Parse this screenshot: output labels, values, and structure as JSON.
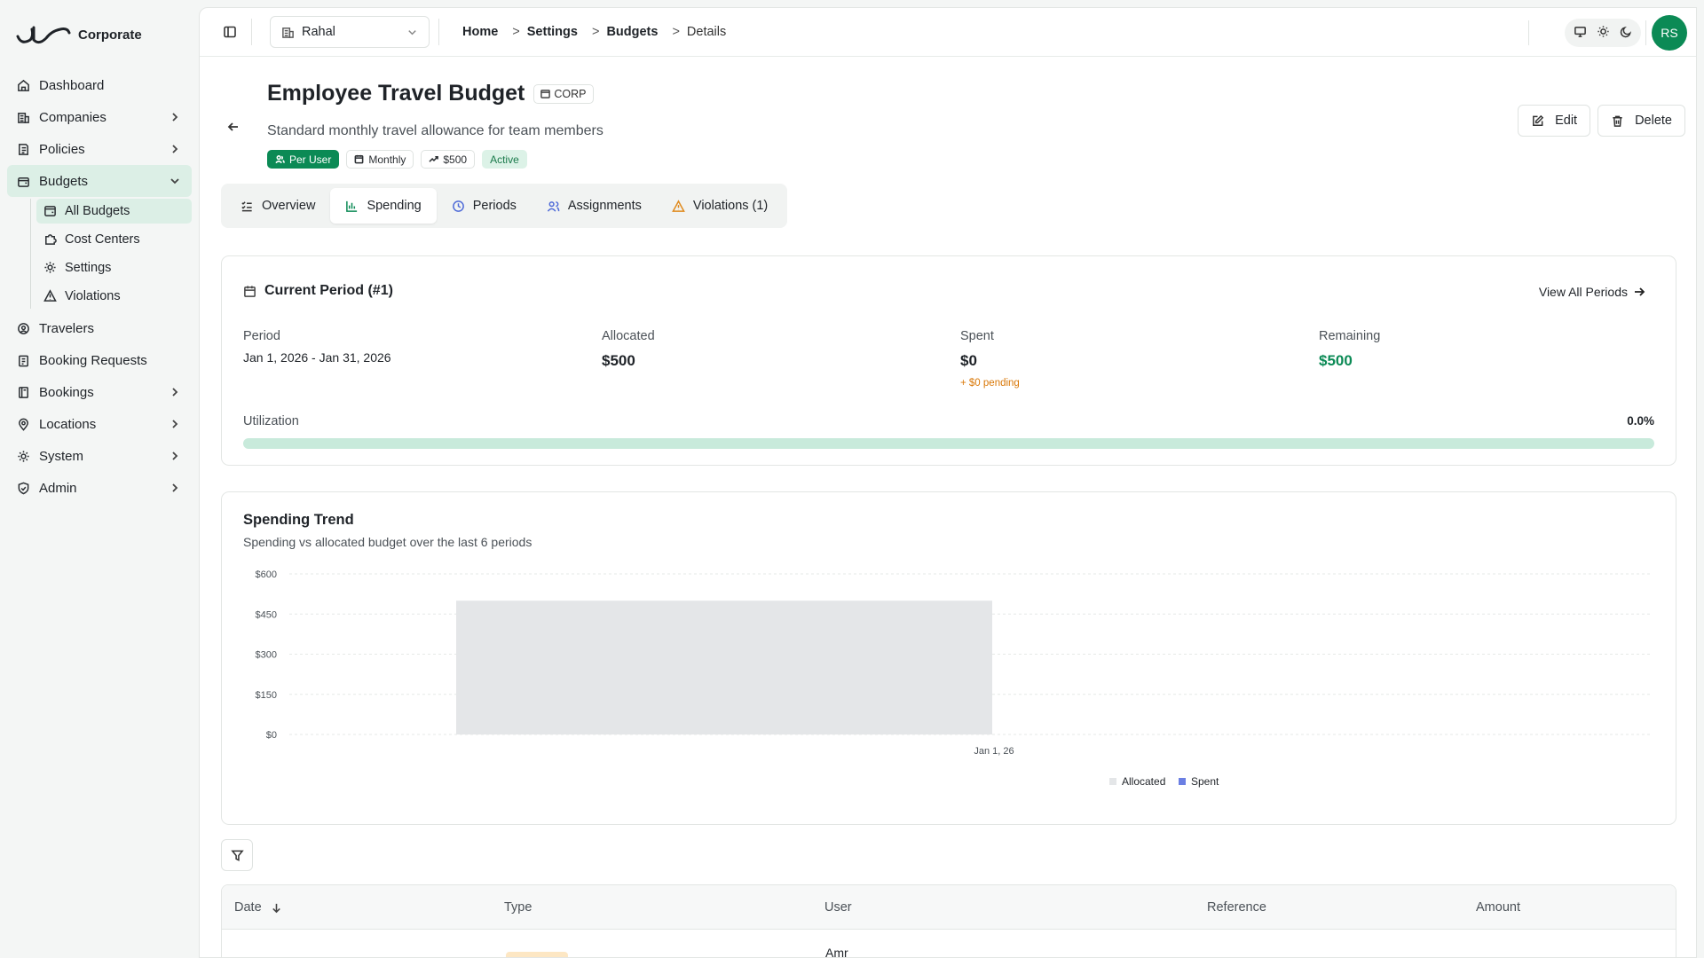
{
  "brand": {
    "name": "Corporate",
    "logo_icon": "logo-icon"
  },
  "sidebar": {
    "items": [
      {
        "label": "Dashboard",
        "icon": "home-icon"
      },
      {
        "label": "Companies",
        "icon": "building-icon"
      },
      {
        "label": "Policies",
        "icon": "policy-icon"
      },
      {
        "label": "Budgets",
        "icon": "wallet-icon"
      },
      {
        "label": "Travelers",
        "icon": "user-circle-icon"
      },
      {
        "label": "Booking Requests",
        "icon": "clipboard-icon"
      },
      {
        "label": "Bookings",
        "icon": "book-icon"
      },
      {
        "label": "Locations",
        "icon": "map-pin-icon"
      },
      {
        "label": "System",
        "icon": "gear-icon"
      },
      {
        "label": "Admin",
        "icon": "shield-icon"
      }
    ],
    "budgets_sub": [
      {
        "label": "All Budgets",
        "icon": "wallet-icon"
      },
      {
        "label": "Cost Centers",
        "icon": "puzzle-icon"
      },
      {
        "label": "Settings",
        "icon": "gear-icon"
      },
      {
        "label": "Violations",
        "icon": "warning-icon"
      }
    ]
  },
  "topbar": {
    "company": "Rahal",
    "breadcrumb": [
      "Home",
      "Settings",
      "Budgets",
      "Details"
    ],
    "breadcrumb_sep": ">",
    "avatar_initials": "RS"
  },
  "budget": {
    "title": "Employee Travel Budget",
    "code": "CORP",
    "description": "Standard monthly travel allowance for team members",
    "chips": {
      "scope": "Per User",
      "frequency": "Monthly",
      "amount": "$500",
      "status": "Active"
    },
    "actions": {
      "edit": "Edit",
      "delete": "Delete"
    }
  },
  "tabs": [
    {
      "label": "Overview",
      "icon": "list-check-icon"
    },
    {
      "label": "Spending",
      "icon": "bar-chart-icon"
    },
    {
      "label": "Periods",
      "icon": "clock-icon"
    },
    {
      "label": "Assignments",
      "icon": "users-icon"
    },
    {
      "label": "Violations (1)",
      "icon": "warning-icon"
    }
  ],
  "active_tab": "Spending",
  "current_period": {
    "title": "Current Period (#1)",
    "view_all": "View All Periods",
    "period_label": "Period",
    "period_value": "Jan 1, 2026 - Jan 31, 2026",
    "allocated_label": "Allocated",
    "allocated_value": "$500",
    "spent_label": "Spent",
    "spent_value": "$0",
    "pending": "+ $0 pending",
    "remaining_label": "Remaining",
    "remaining_value": "$500",
    "utilization_label": "Utilization",
    "utilization_value": "0.0%",
    "utilization_fraction": 0.0
  },
  "trend": {
    "title": "Spending Trend",
    "subtitle": "Spending vs allocated budget over the last 6 periods"
  },
  "chart_data": {
    "type": "bar",
    "categories": [
      "Jan 1, 26"
    ],
    "series": [
      {
        "name": "Allocated",
        "values": [
          500
        ],
        "color": "#e4e6e8"
      },
      {
        "name": "Spent",
        "values": [
          0
        ],
        "color": "#6b7fe3"
      }
    ],
    "ylim": [
      0,
      600
    ],
    "yticks": [
      0,
      150,
      300,
      450,
      600
    ],
    "ytick_labels": [
      "$0",
      "$150",
      "$300",
      "$450",
      "$600"
    ],
    "grid": true,
    "legend": "bottom-center"
  },
  "table": {
    "columns": [
      "Date",
      "Type",
      "User",
      "Reference",
      "Amount"
    ],
    "rows": [
      {
        "user": "Amr"
      }
    ]
  },
  "colors": {
    "accent": "#0b8a55",
    "pending": "#d97706",
    "violation": "#e08a1e",
    "tab_icon": "#4f6bd8"
  }
}
